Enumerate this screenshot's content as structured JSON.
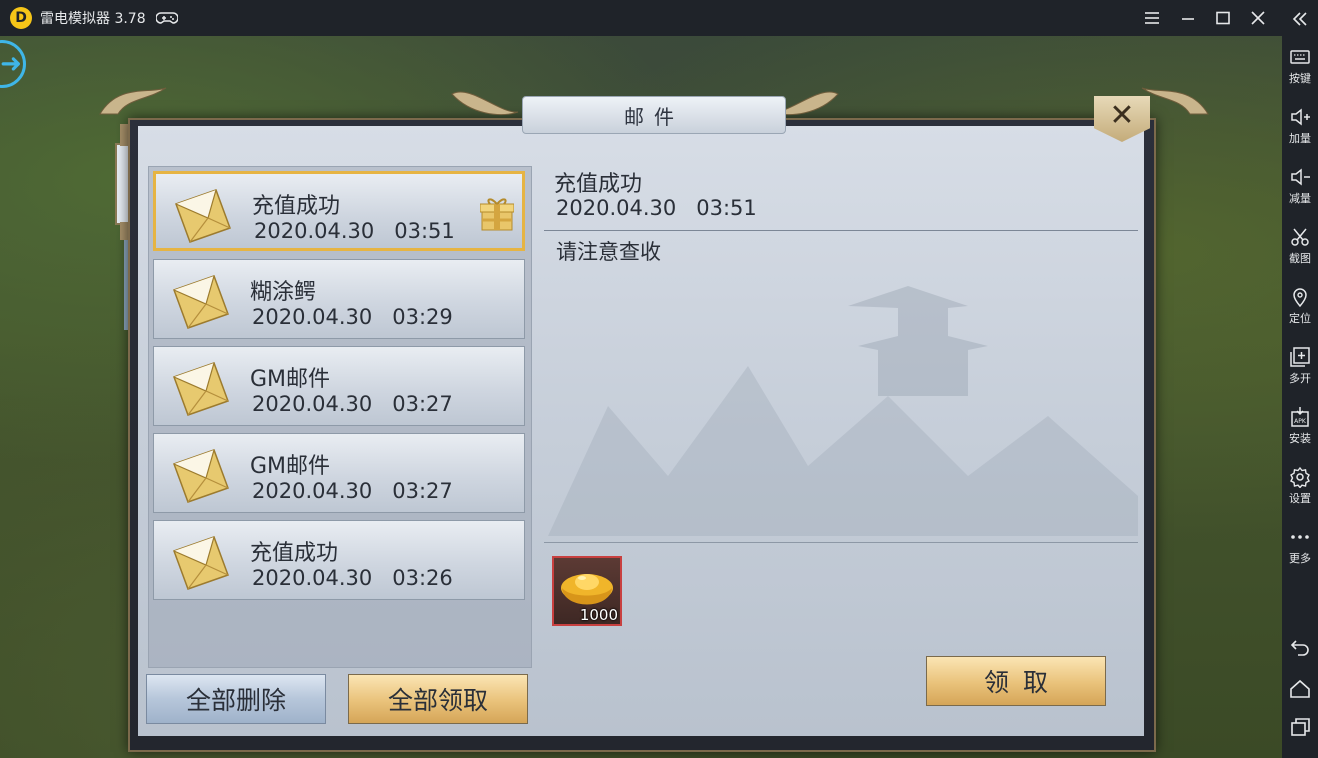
{
  "window": {
    "app_title": "雷电模拟器 3.78",
    "logo_text": "D"
  },
  "sidebar": {
    "items": [
      {
        "label": "按键",
        "icon": "keyboard-icon"
      },
      {
        "label": "加量",
        "icon": "volume-up-icon"
      },
      {
        "label": "减量",
        "icon": "volume-down-icon"
      },
      {
        "label": "截图",
        "icon": "scissors-icon"
      },
      {
        "label": "定位",
        "icon": "location-pin-icon"
      },
      {
        "label": "多开",
        "icon": "multi-instance-icon"
      },
      {
        "label": "安装",
        "icon": "apk-install-icon"
      },
      {
        "label": "设置",
        "icon": "gear-icon"
      },
      {
        "label": "更多",
        "icon": "more-dots-icon"
      }
    ]
  },
  "dialog": {
    "title": "邮件",
    "close_glyph": "✕"
  },
  "mails": [
    {
      "title": "充值成功",
      "datetime": "2020.04.30   03:51",
      "selected": true,
      "has_gift": true
    },
    {
      "title": "糊涂鳄",
      "datetime": "2020.04.30   03:29",
      "selected": false,
      "has_gift": false
    },
    {
      "title": "GM邮件",
      "datetime": "2020.04.30   03:27",
      "selected": false,
      "has_gift": false
    },
    {
      "title": "GM邮件",
      "datetime": "2020.04.30   03:27",
      "selected": false,
      "has_gift": false
    },
    {
      "title": "充值成功",
      "datetime": "2020.04.30   03:26",
      "selected": false,
      "has_gift": false
    }
  ],
  "detail": {
    "title": "充值成功",
    "datetime": "2020.04.30   03:51",
    "body": "请注意查收",
    "attachment": {
      "icon": "gold-ingot-icon",
      "count": "1000"
    }
  },
  "buttons": {
    "delete_all": "全部删除",
    "claim_all": "全部领取",
    "claim": "领取"
  },
  "colors": {
    "selected_border": "#e6b443",
    "attachment_border": "#c84040",
    "accent_blue": "#3fb6e8"
  }
}
